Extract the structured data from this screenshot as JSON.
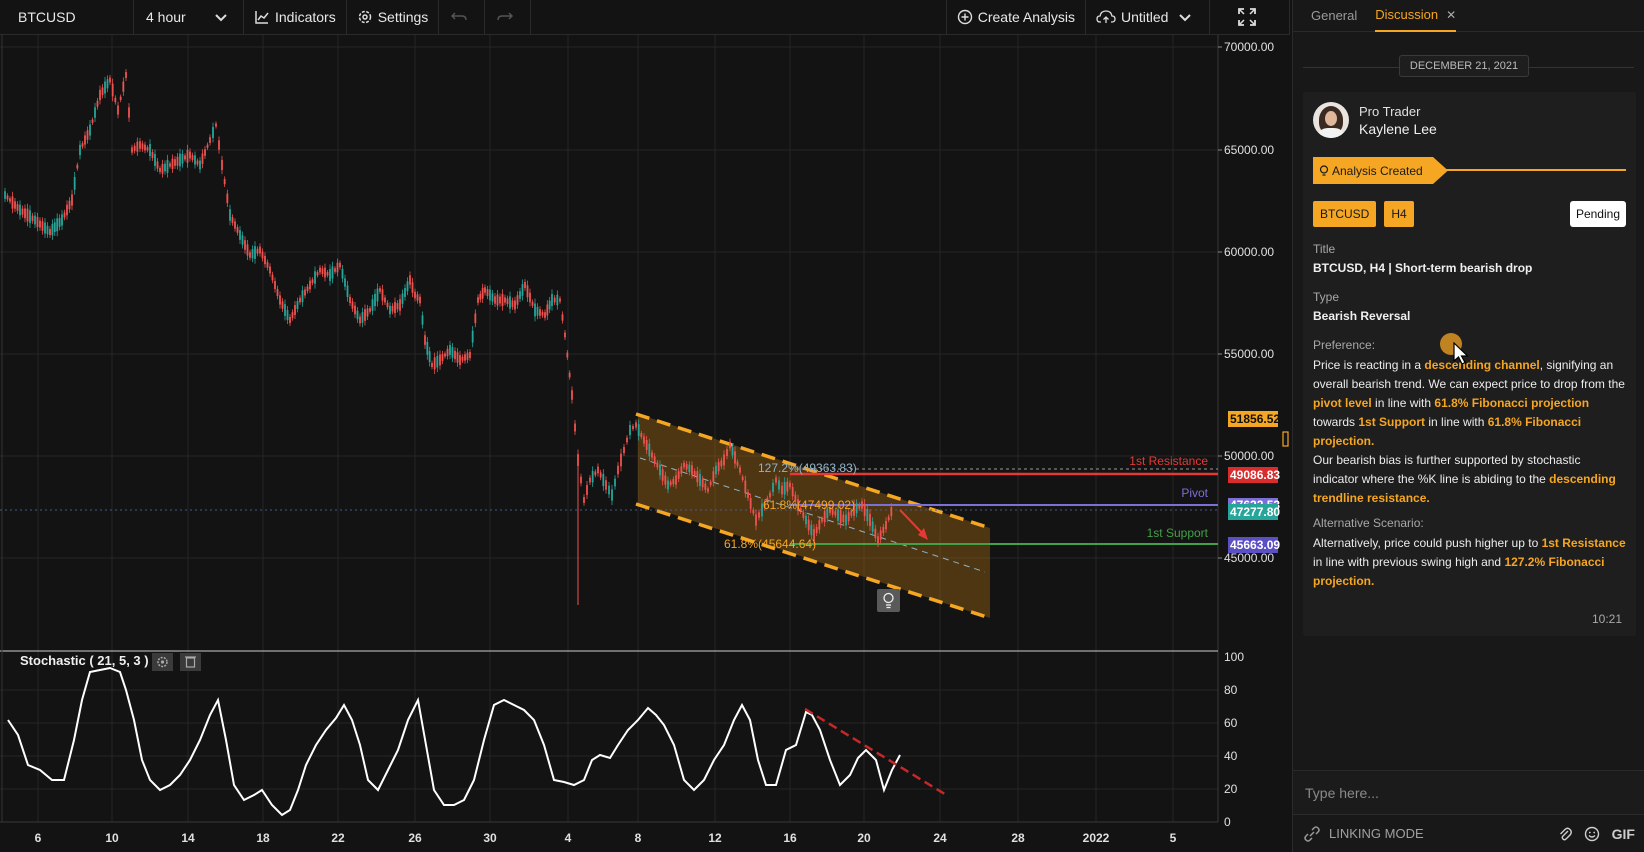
{
  "toolbar": {
    "symbol": "BTCUSD",
    "interval": "4 hour",
    "indicators_label": "Indicators",
    "settings_label": "Settings",
    "create_analysis_label": "Create Analysis",
    "layout_name": "Untitled"
  },
  "chart": {
    "price_labels": [
      "70000.00",
      "65000.00",
      "60000.00",
      "55000.00",
      "50000.00",
      "45000.00"
    ],
    "price_badges": [
      {
        "text": "51856.52",
        "color": "#f5a623"
      },
      {
        "text": "49086.83",
        "color": "#d92c2c"
      },
      {
        "text": "47622.53",
        "color": "#7c6fd6"
      },
      {
        "text": "47277.80",
        "color": "#26a69a"
      },
      {
        "text": "45663.09",
        "color": "#5b4fc4"
      }
    ],
    "date_labels": [
      "6",
      "10",
      "14",
      "18",
      "22",
      "26",
      "30",
      "4",
      "8",
      "12",
      "16",
      "20",
      "24",
      "28",
      "2022",
      "5"
    ],
    "annotations": {
      "resistance": "1st Resistance",
      "pivot": "Pivot",
      "support": "1st Support",
      "fib_127": "127.2%(49363.83)",
      "fib_618_upper": "61.8%(47499.02)",
      "fib_618_lower": "61.8%(45644.64)"
    },
    "indicator_name": "Stochastic ( 21, 5, 3 )",
    "osc_labels": [
      "100",
      "80",
      "60",
      "40",
      "20",
      "0"
    ]
  },
  "panel": {
    "tabs": [
      "General",
      "Discussion"
    ],
    "date": "DECEMBER 21, 2021",
    "author_role": "Pro Trader",
    "author_name": "Kaylene Lee",
    "status_flag": "Analysis Created",
    "tag_symbol": "BTCUSD",
    "tag_interval": "H4",
    "status": "Pending",
    "title_label": "Title",
    "title": "BTCUSD, H4 | Short-term bearish drop",
    "type_label": "Type",
    "type": "Bearish Reversal",
    "preference_label": "Preference:",
    "pref": {
      "t1": "Price is reacting in a ",
      "h1": "descending channel",
      "t2": ", signifying an overall bearish trend. We can expect price to drop from the ",
      "h2": "pivot level",
      "t3": " in line with ",
      "h3": "61.8% Fibonacci projection",
      "t4": " towards ",
      "h4": "1st Support",
      "t5": " in line with ",
      "h5": "61.8% Fibonacci projection.",
      "t6": "Our bearish bias is further supported by stochastic indicator where the %K line is abiding to the ",
      "h6": "descending trendline resistance."
    },
    "alt_label": "Alternative Scenario:",
    "alt": {
      "t1": "Alternatively, price could push higher up to ",
      "h1": "1st Resistance",
      "t2": " in line with previous swing high and ",
      "h2": "127.2% Fibonacci projection."
    },
    "time": "10:21",
    "input_placeholder": "Type here...",
    "linking_mode": "LINKING MODE",
    "gif": "GIF"
  }
}
